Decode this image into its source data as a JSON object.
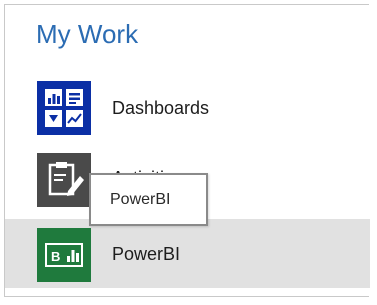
{
  "title": "My Work",
  "items": [
    {
      "label": "Dashboards",
      "icon": "dashboards-icon"
    },
    {
      "label": "Activities",
      "icon": "activities-icon"
    },
    {
      "label": "PowerBI",
      "icon": "powerbi-icon"
    }
  ],
  "tooltip": {
    "text": "PowerBI"
  },
  "colors": {
    "title": "#2b6cb3",
    "dashboards_tile": "#0b2fa5",
    "activities_tile": "#4a4a4a",
    "powerbi_tile": "#1f7a3d",
    "selected_row": "#e1e1e1"
  }
}
